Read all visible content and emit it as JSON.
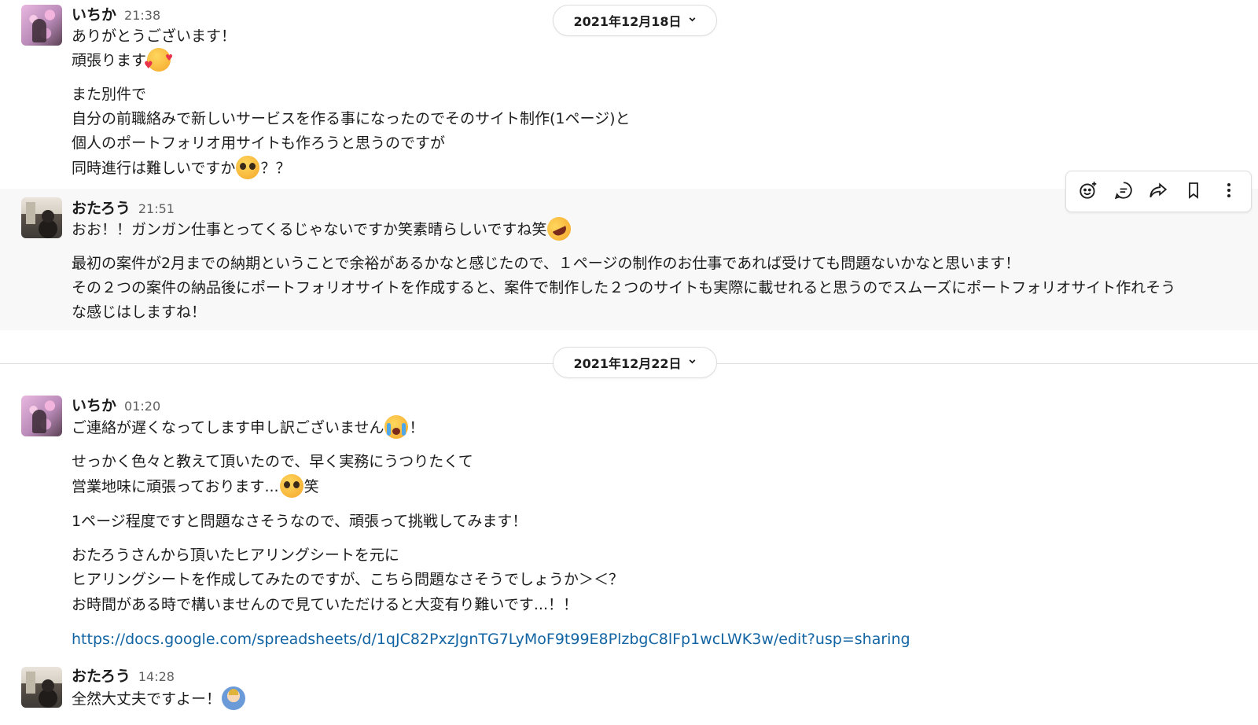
{
  "date_separators": [
    "2021年12月18日",
    "2021年12月22日"
  ],
  "messages": [
    {
      "sender": "いちか",
      "time": "21:38",
      "lines": [
        "ありがとうございます！",
        "頑張ります",
        "また別件で",
        "自分の前職絡みで新しいサービスを作る事になったのでそのサイト制作(1ページ)と",
        "個人のポートフォリオ用サイトも作ろうと思うのですが",
        "同時進行は難しいですか",
        "？？"
      ]
    },
    {
      "sender": "おたろう",
      "time": "21:51",
      "lines": [
        "おお！！ガンガン仕事とってくるじゃないですか笑素晴らしいですね笑",
        "最初の案件が2月までの納期ということで余裕があるかなと感じたので、１ページの制作のお仕事であれば受けても問題ないかなと思います！",
        "その２つの案件の納品後にポートフォリオサイトを作成すると、案件で制作した２つのサイトも実際に載せれると思うのでスムーズにポートフォリオサイト作れそう",
        "な感じはしますね！"
      ]
    },
    {
      "sender": "いちか",
      "time": "01:20",
      "lines": [
        "ご連絡が遅くなってします申し訳ございません",
        "！",
        "せっかく色々と教えて頂いたので、早く実務にうつりたくて",
        "営業地味に頑張っております...",
        "笑",
        "1ページ程度ですと問題なさそうなので、頑張って挑戦してみます！",
        "おたろうさんから頂いたヒアリングシートを元に",
        "ヒアリングシートを作成してみたのですが、こちら問題なさそうでしょうか＞＜？",
        "お時間がある時で構いませんので見ていただけると大変有り難いです...！！",
        "https://docs.google.com/spreadsheets/d/1qJC82PxzJgnTG7LyMoF9t99E8PlzbgC8lFp1wcLWK3w/edit?usp=sharing"
      ]
    },
    {
      "sender": "おたろう",
      "time": "14:28",
      "lines": [
        "全然大丈夫ですよー！"
      ]
    }
  ],
  "colors": {
    "link": "#1264a3",
    "hover_bg": "#f8f8f8",
    "timestamp": "#616061"
  },
  "toolbar_icons": [
    "add-reaction-icon",
    "reply-thread-icon",
    "share-icon",
    "bookmark-icon",
    "more-actions-icon"
  ]
}
